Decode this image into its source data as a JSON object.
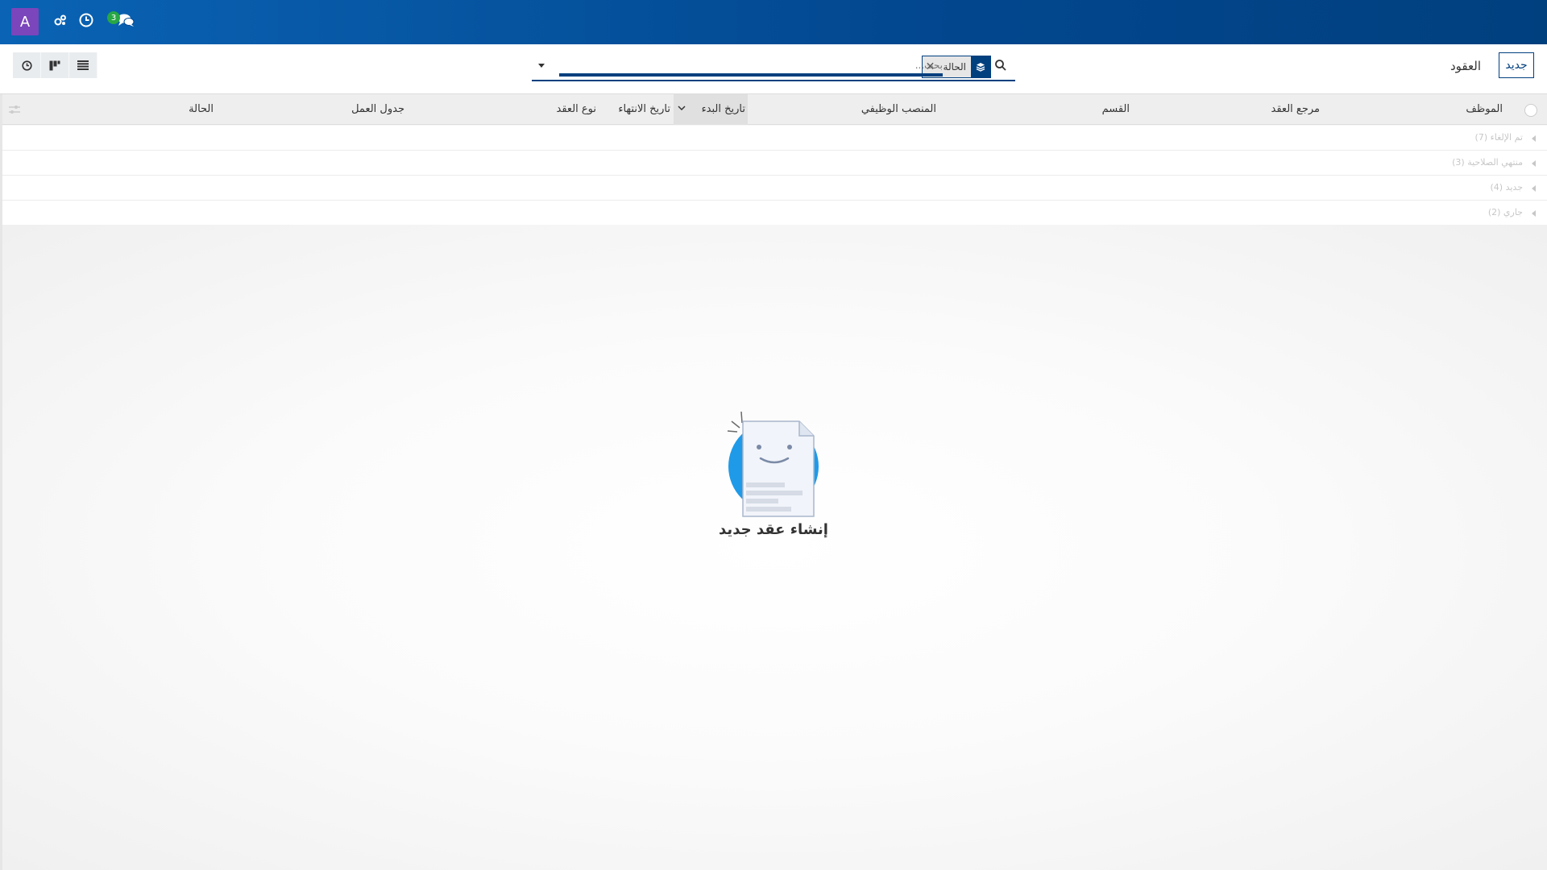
{
  "navbar": {
    "avatar_letter": "A",
    "avatar_color": "#7b45bb",
    "icons": [
      "activity-icon",
      "clock-icon",
      "chat-icon"
    ],
    "chat_badge": "3",
    "badge_color": "#28a745"
  },
  "control_panel": {
    "new_button": "جديد",
    "breadcrumb": "العقود",
    "search": {
      "facet_label": "الحالة",
      "placeholder": "بحث..."
    },
    "views": [
      "activity-view",
      "kanban-view",
      "list-view"
    ]
  },
  "table": {
    "columns": {
      "employee": "الموظف",
      "contract_ref": "مرجع العقد",
      "department": "القسم",
      "job_position": "المنصب الوظيفي",
      "start_date": "تاريخ البدء",
      "end_date": "تاريخ الانتهاء",
      "contract_type": "نوع العقد",
      "work_schedule": "جدول العمل",
      "status": "الحالة"
    },
    "groups": [
      {
        "label": "تم الإلغاء (7)"
      },
      {
        "label": "منتهي الصلاحية (3)"
      },
      {
        "label": "جديد (4)"
      },
      {
        "label": "جاري (2)"
      }
    ]
  },
  "empty_state": {
    "title": "إنشاء عقد جديد"
  },
  "colors": {
    "primary": "#01407f",
    "navbar_gradient_start": "#0a63b4",
    "illustration_blue": "#1f9ae8"
  }
}
